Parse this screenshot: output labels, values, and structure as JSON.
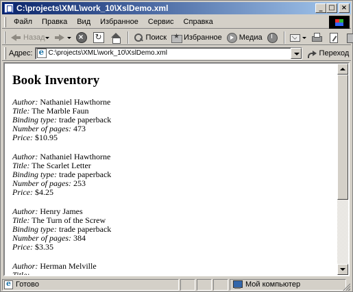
{
  "window": {
    "title": "C:\\projects\\XML\\work_10\\XslDemo.xml"
  },
  "menu": {
    "items": [
      "Файл",
      "Правка",
      "Вид",
      "Избранное",
      "Сервис",
      "Справка"
    ]
  },
  "toolbar": {
    "back_label": "Назад",
    "search_label": "Поиск",
    "favorites_label": "Избранное",
    "media_label": "Медиа"
  },
  "address": {
    "label": "Адрес:",
    "value": "C:\\projects\\XML\\work_10\\XslDemo.xml",
    "go_label": "Переход"
  },
  "document": {
    "heading": "Book Inventory",
    "labels": {
      "author": "Author:",
      "title": "Title:",
      "binding": "Binding type:",
      "pages": "Number of pages:",
      "price": "Price:"
    },
    "books": [
      {
        "author": "Nathaniel Hawthorne",
        "title": "The Marble Faun",
        "binding": "trade paperback",
        "pages": "473",
        "price": "$10.95"
      },
      {
        "author": "Nathaniel Hawthorne",
        "title": "The Scarlet Letter",
        "binding": "trade paperback",
        "pages": "253",
        "price": "$4.25"
      },
      {
        "author": "Henry James",
        "title": "The Turn of the Screw",
        "binding": "trade paperback",
        "pages": "384",
        "price": "$3.35"
      },
      {
        "author": "Herman Melville",
        "title": "",
        "binding": "",
        "pages": "",
        "price": ""
      }
    ]
  },
  "scroll": {
    "visible_fraction": 0.66,
    "position_fraction": 0.0
  },
  "status": {
    "text": "Готово",
    "zone": "Мой компьютер"
  },
  "colors": {
    "titlebar_start": "#0a246a",
    "titlebar_end": "#a6caf0",
    "chrome": "#d4d0c8"
  }
}
